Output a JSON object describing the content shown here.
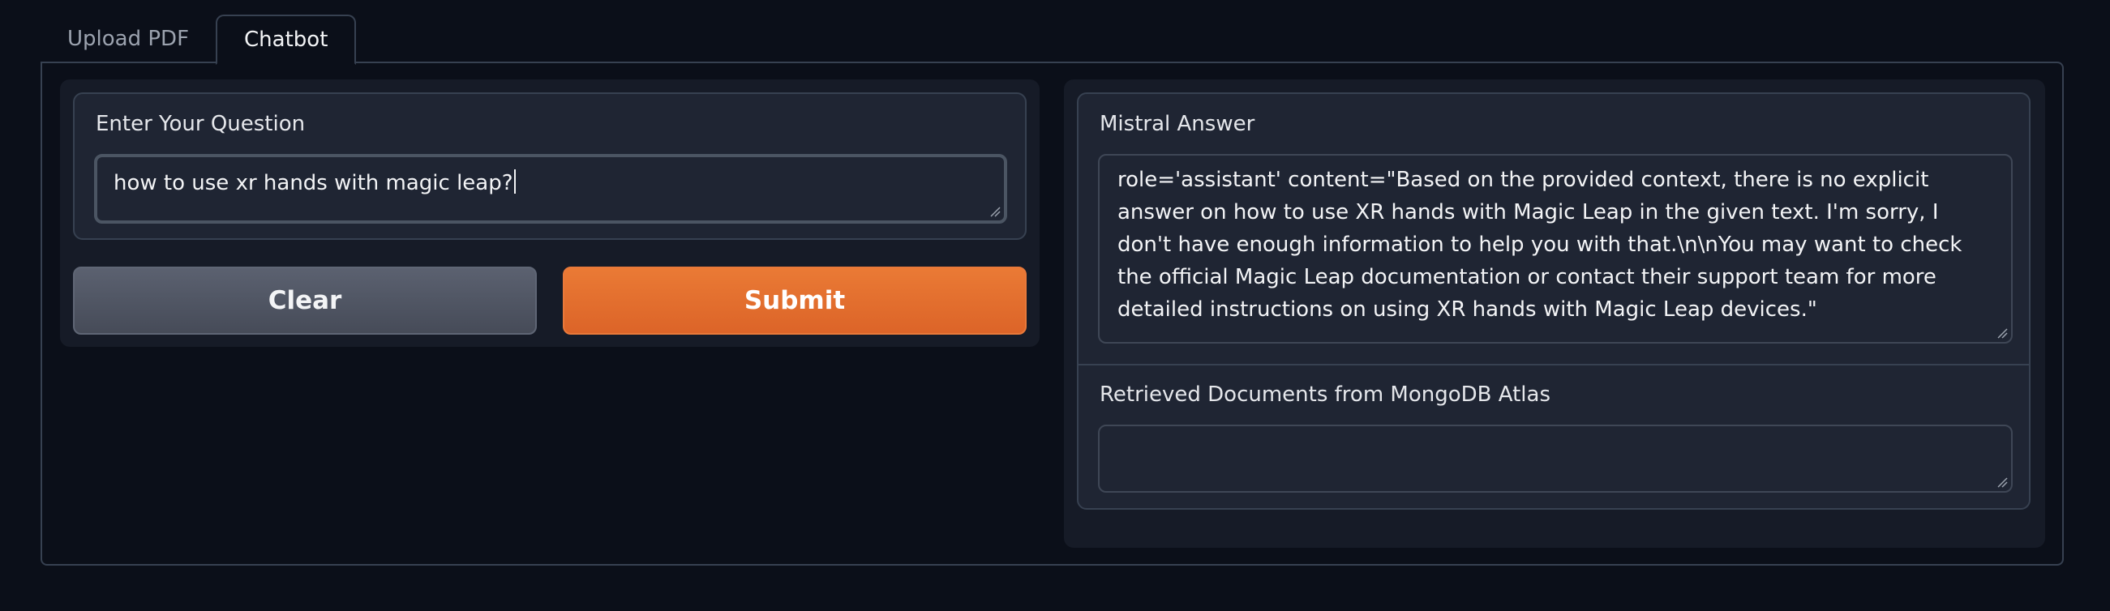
{
  "tabs": [
    {
      "label": "Upload PDF",
      "active": false
    },
    {
      "label": "Chatbot",
      "active": true
    }
  ],
  "question": {
    "label": "Enter Your Question",
    "value": "how to use xr hands with magic leap?"
  },
  "buttons": {
    "clear_label": "Clear",
    "submit_label": "Submit"
  },
  "answer": {
    "label": "Mistral Answer",
    "value": "role='assistant' content=\"Based on the provided context, there is no explicit answer on how to use XR hands with Magic Leap in the given text. I'm sorry, I don't have enough information to help you with that.\\n\\nYou may want to check the official Magic Leap documentation or contact their support team for more detailed instructions on using XR hands with Magic Leap devices.\""
  },
  "documents": {
    "label": "Retrieved Documents from MongoDB Atlas",
    "value": ""
  },
  "colors": {
    "background": "#0b0f19",
    "panel": "#1f2533",
    "accent_orange": "#e8742f",
    "clear_gray": "#4f5563"
  }
}
